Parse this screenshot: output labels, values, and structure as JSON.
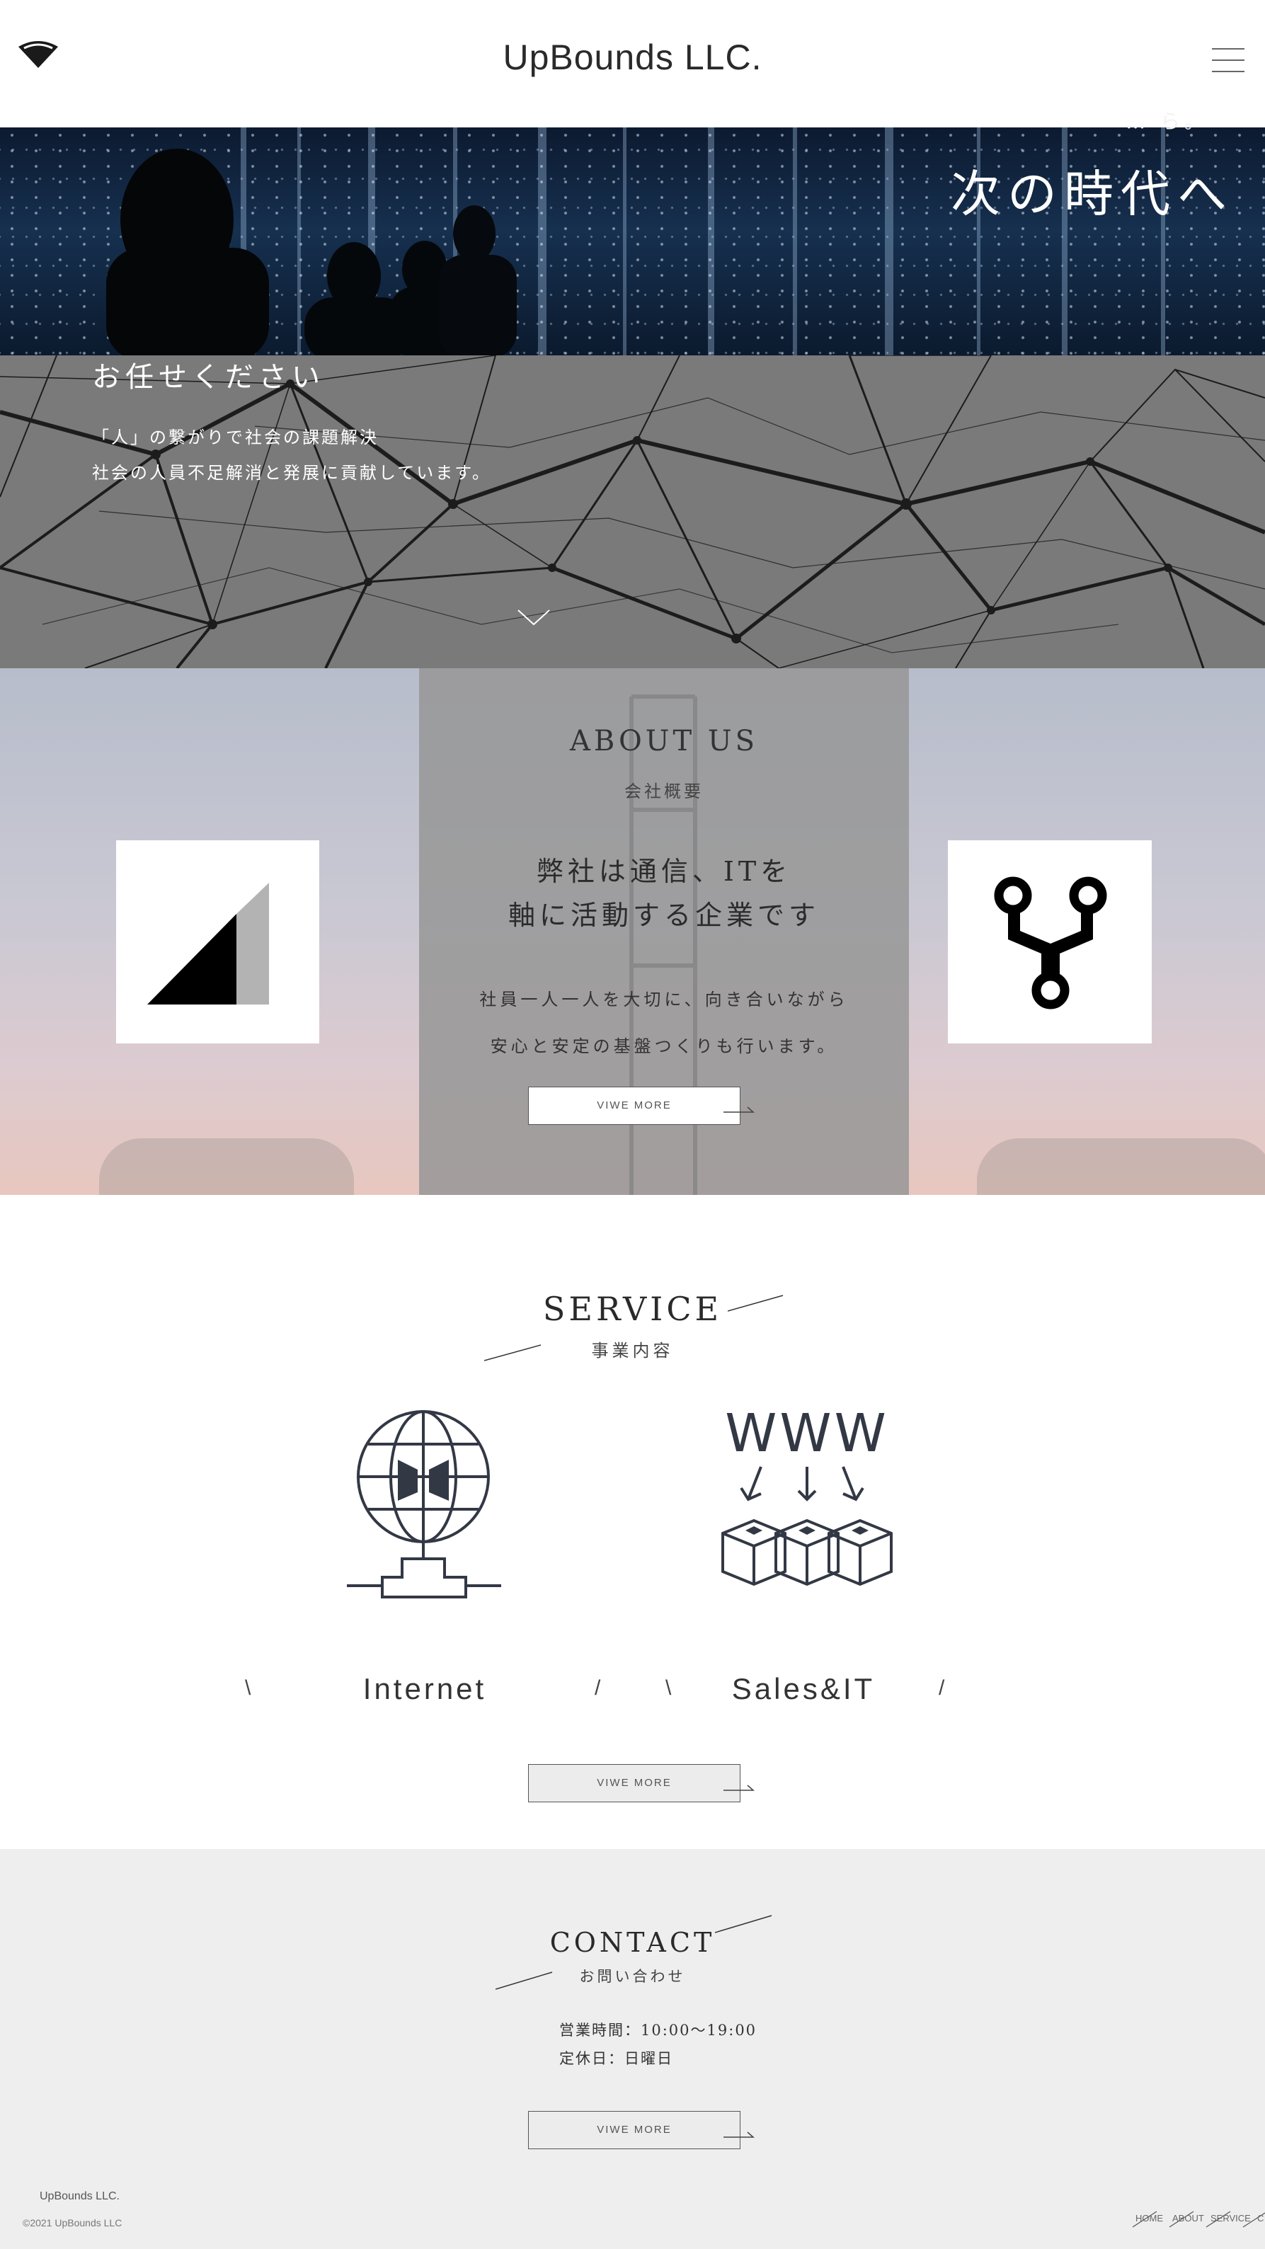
{
  "header": {
    "site_title": "UpBounds LLC."
  },
  "hero": {
    "subtitle": "… ら。",
    "title": "次の時代へ",
    "heading": "お任せください",
    "line1": "「人」の繋がりで社会の課題解決",
    "line2": "社会の人員不足解消と発展に貢献しています。"
  },
  "about": {
    "title": "ABOUT US",
    "subtitle": "会社概要",
    "headline_1": "弊社は通信、ITを",
    "headline_2": "軸に活動する企業です",
    "text_1": "社員一人一人を大切に、向き合いながら",
    "text_2": "安心と安定の基盤つくりも行います。",
    "button_label": "VIWE MORE"
  },
  "service": {
    "title": "SERVICE",
    "subtitle": "事業内容",
    "items": [
      {
        "label": "Internet",
        "icon": "globe-network-icon"
      },
      {
        "label": "Sales&IT",
        "icon": "www-boxes-icon"
      }
    ],
    "slash_open": "\\",
    "slash_close": "/",
    "button_label": "VIWE MORE"
  },
  "contact": {
    "title": "CONTACT",
    "subtitle": "お問い合わせ",
    "hours": "営業時間：10:00～19:00",
    "holiday": "定休日：日曜日",
    "button_label": "VIWE MORE"
  },
  "footer": {
    "logo": "UpBounds LLC.",
    "copyright": "©2021 UpBounds LLC",
    "nav": [
      "HOME",
      "ABOUT",
      "SERVICE",
      "C"
    ]
  },
  "colors": {
    "hero_top": "#122844",
    "hero_bottom": "#7a7a7a",
    "about_panel": "#969696",
    "contact_bg": "#eeeeee"
  }
}
